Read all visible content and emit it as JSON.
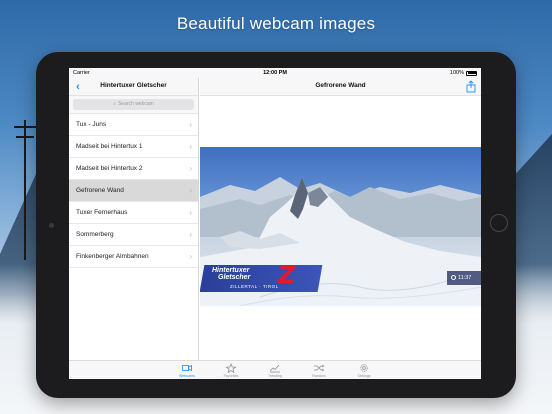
{
  "headline": "Beautiful webcam images",
  "status_bar": {
    "carrier": "Carrier",
    "time": "12:00 PM",
    "battery": "100%"
  },
  "master": {
    "title": "Hintertuxer Gletscher",
    "search_placeholder": "Search webcam",
    "items": [
      {
        "label": "Tux - Juns",
        "selected": false
      },
      {
        "label": "Madseit bei Hintertux 1",
        "selected": false
      },
      {
        "label": "Madseit bei Hintertux 2",
        "selected": false
      },
      {
        "label": "Gefrorene Wand",
        "selected": true
      },
      {
        "label": "Tuxer Fernerhaus",
        "selected": false
      },
      {
        "label": "Sommerberg",
        "selected": false
      },
      {
        "label": "Finkenberger Almbahnen",
        "selected": false
      }
    ]
  },
  "detail": {
    "title": "Gefrorene Wand",
    "webcam": {
      "brand_line1": "Hintertuxer",
      "brand_line2": "Gletscher",
      "brand_sub": "ZILLERTAL · TIROL",
      "timestamp": "11:37"
    }
  },
  "tabs": [
    {
      "label": "Webcams",
      "icon": "video-camera-icon",
      "active": true
    },
    {
      "label": "Favorites",
      "icon": "star-icon",
      "active": false
    },
    {
      "label": "Trending",
      "icon": "chart-icon",
      "active": false
    },
    {
      "label": "Random",
      "icon": "shuffle-icon",
      "active": false
    },
    {
      "label": "Settings",
      "icon": "gear-icon",
      "active": false
    }
  ],
  "colors": {
    "accent": "#1a8cff",
    "selected_row": "#d9d9d9",
    "brand_blue": "#2a3f9a",
    "brand_red": "#e21b2a"
  }
}
